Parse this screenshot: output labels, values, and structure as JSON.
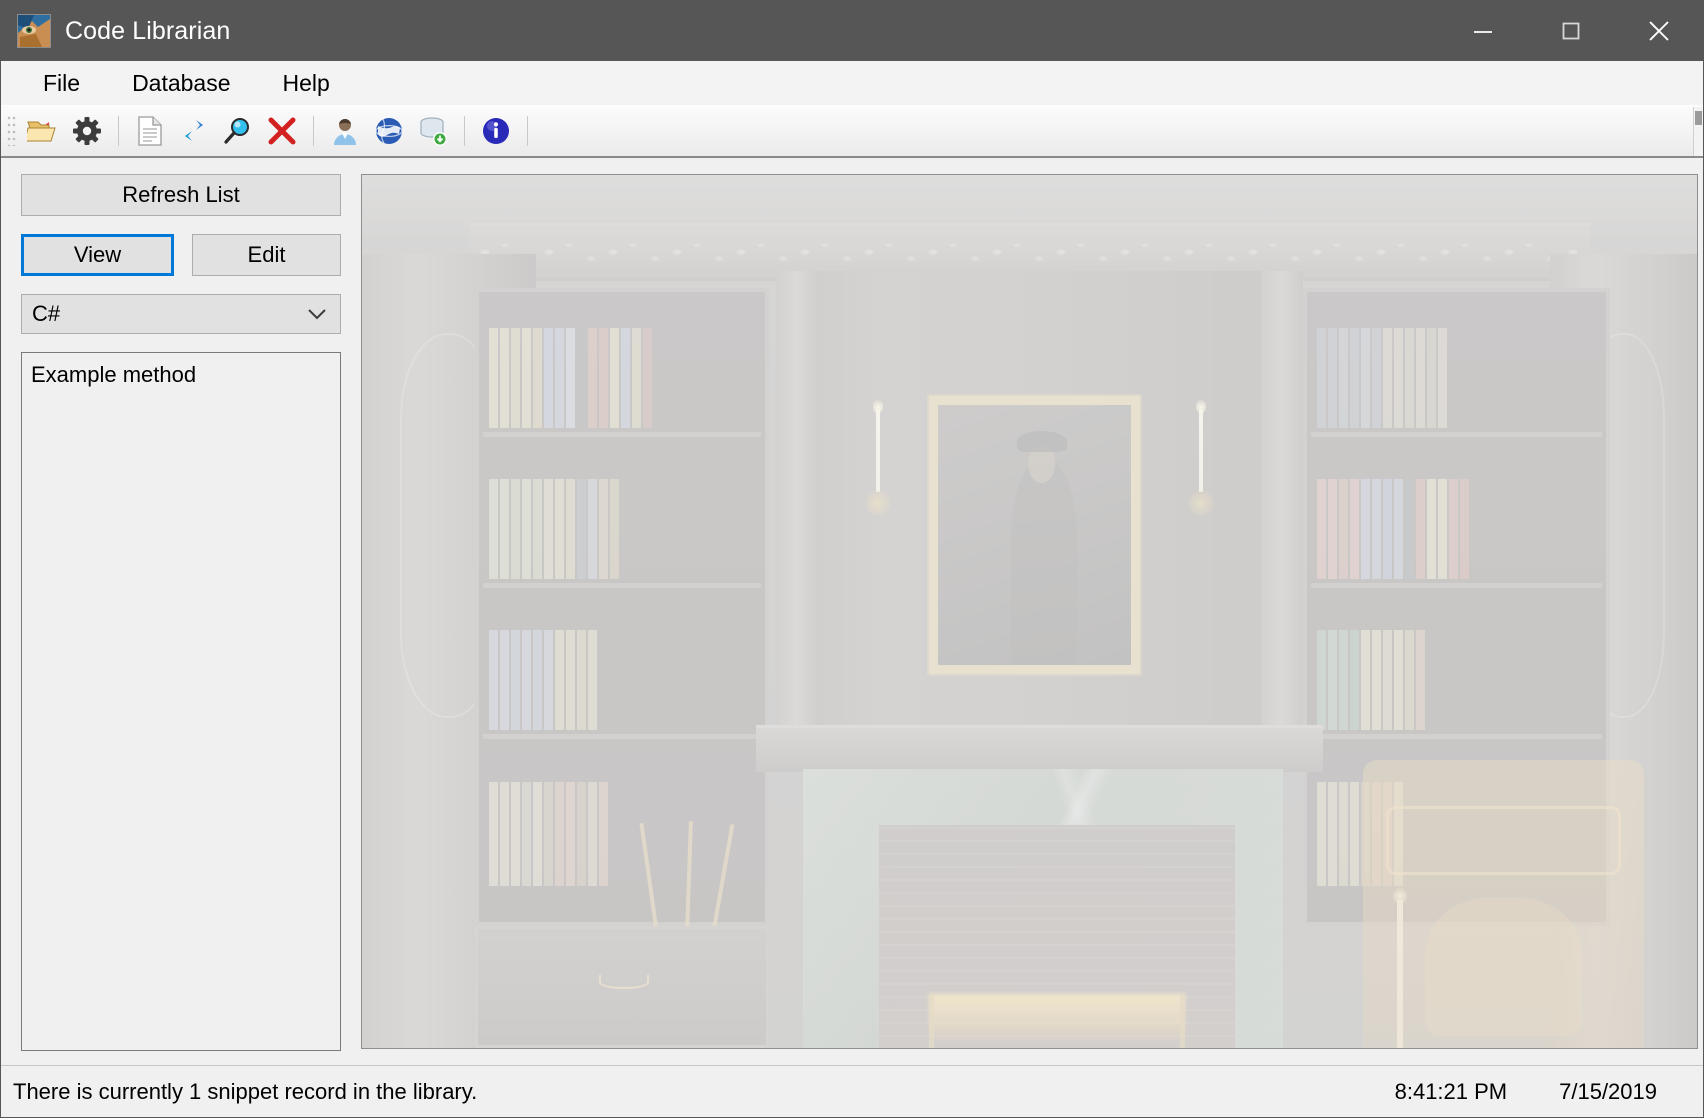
{
  "window": {
    "title": "Code Librarian",
    "app_icon": "app-portrait-icon",
    "controls": {
      "minimize": "minimize-icon",
      "maximize": "maximize-icon",
      "close": "close-icon"
    }
  },
  "menu": {
    "items": [
      {
        "label": "File"
      },
      {
        "label": "Database"
      },
      {
        "label": "Help"
      }
    ]
  },
  "toolbar": {
    "buttons": [
      {
        "name": "open-folder-icon",
        "tip": "Open"
      },
      {
        "name": "gear-icon",
        "tip": "Settings"
      },
      {
        "name": "new-document-icon",
        "tip": "New Snippet"
      },
      {
        "name": "refresh-icon",
        "tip": "Refresh"
      },
      {
        "name": "search-icon",
        "tip": "Search"
      },
      {
        "name": "delete-x-icon",
        "tip": "Delete"
      },
      {
        "name": "user-icon",
        "tip": "User"
      },
      {
        "name": "globe-icon",
        "tip": "Web"
      },
      {
        "name": "database-add-icon",
        "tip": "Add Database"
      },
      {
        "name": "info-icon",
        "tip": "About"
      }
    ]
  },
  "left_panel": {
    "refresh_button": "Refresh List",
    "view_button": "View",
    "edit_button": "Edit",
    "language_combo": {
      "selected": "C#",
      "options": [
        "C#"
      ]
    },
    "snippet_list": [
      {
        "label": "Example method"
      }
    ]
  },
  "preview": {
    "image_description": "Faded photograph of a wood-panelled library with bookcases, framed Renaissance portrait, candle sconces, marble fireplace and carved wooden chair"
  },
  "status_bar": {
    "message": "There is currently 1 snippet record in the library.",
    "time": "8:41:21 PM",
    "date": "7/15/2019"
  },
  "colors": {
    "titlebar": "#565656",
    "accent_focus": "#0078d7",
    "window_face": "#f0f0f0",
    "button_face": "#e1e1e1"
  }
}
